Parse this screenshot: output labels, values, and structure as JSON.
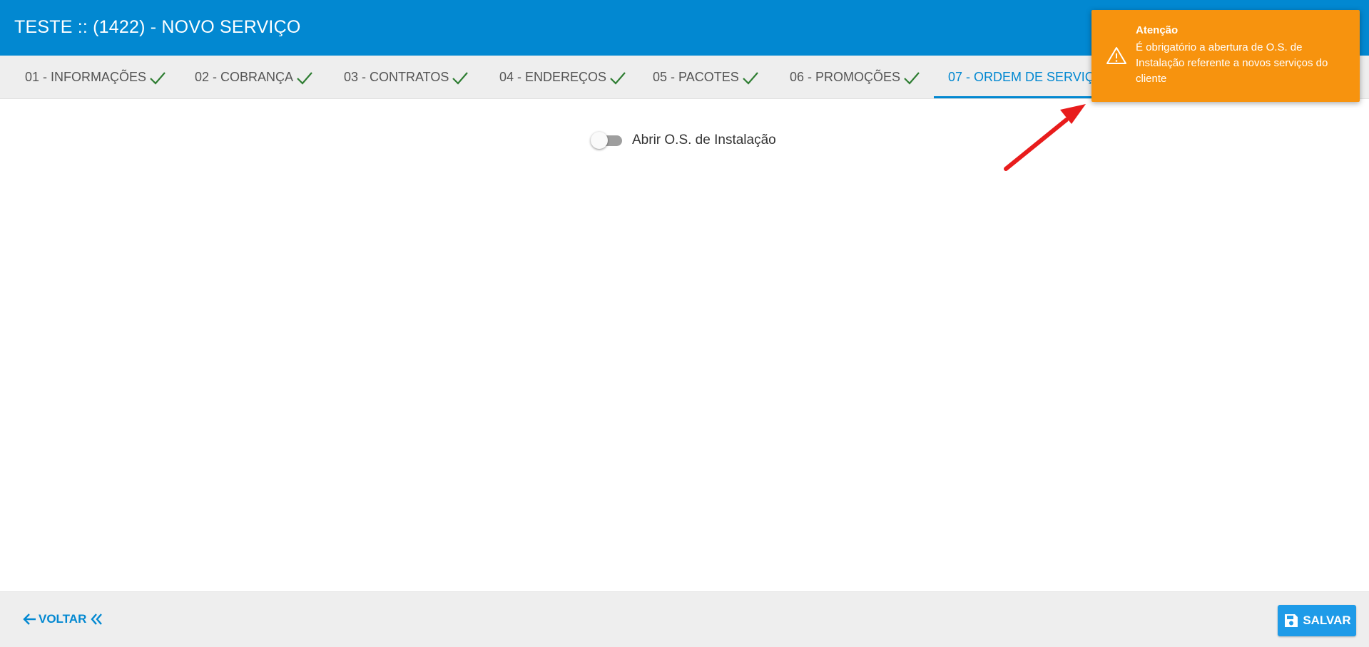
{
  "header": {
    "title": "TESTE :: (1422) - NOVO SERVIÇO"
  },
  "tabs": [
    {
      "label": "01 - INFORMAÇÕES",
      "completed": true
    },
    {
      "label": "02 - COBRANÇA",
      "completed": true
    },
    {
      "label": "03 - CONTRATOS",
      "completed": true
    },
    {
      "label": "04 - ENDEREÇOS",
      "completed": true
    },
    {
      "label": "05 - PACOTES",
      "completed": true
    },
    {
      "label": "06 - PROMOÇÕES",
      "completed": true
    },
    {
      "label": "07 - ORDEM DE SERVIÇO",
      "completed": false,
      "active": true
    }
  ],
  "main": {
    "toggle_label": "Abrir O.S. de Instalação",
    "toggle_on": false
  },
  "footer": {
    "back_label": "VOLTAR",
    "save_label": "SALVAR"
  },
  "toast": {
    "title": "Atenção",
    "message": "É obrigatório a abertura de O.S. de Instalação referente a novos serviços do cliente"
  },
  "colors": {
    "primary": "#0288d1",
    "check": "#2e7d32",
    "toast": "#f7930e",
    "annotation_arrow": "#e81c1c"
  }
}
